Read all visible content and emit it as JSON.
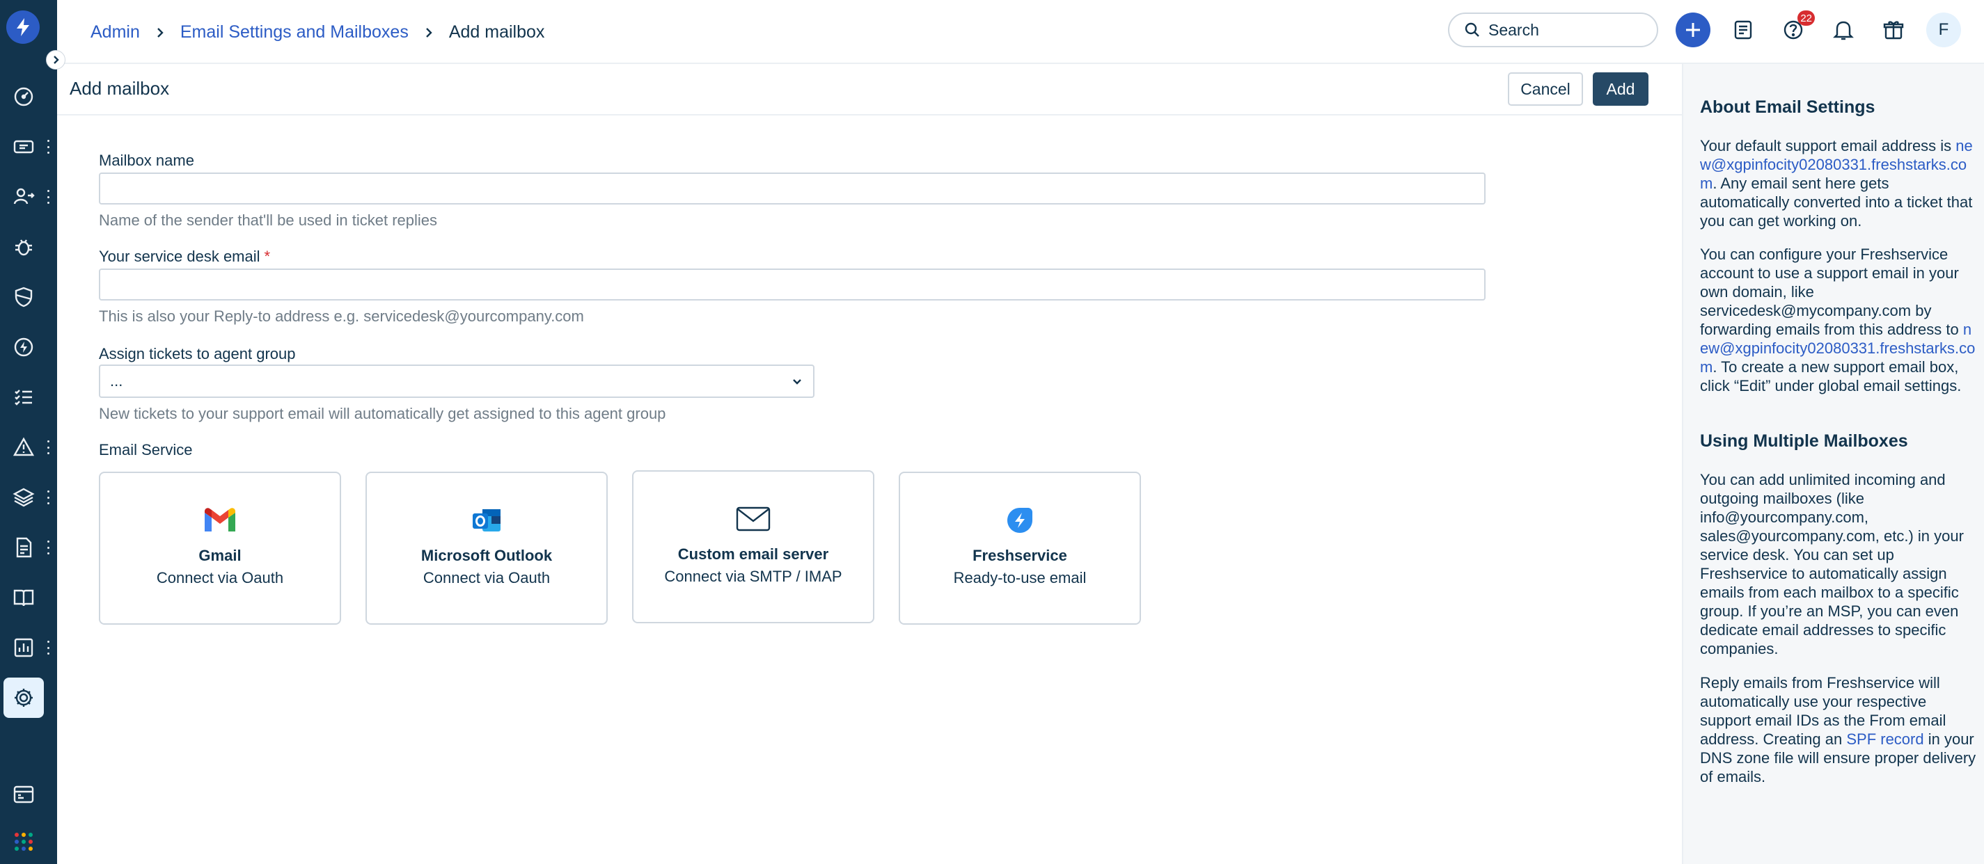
{
  "breadcrumb": {
    "items": [
      "Admin",
      "Email Settings and Mailboxes",
      "Add mailbox"
    ]
  },
  "header": {
    "search_placeholder": "Search",
    "notification_count": "22",
    "avatar_initial": "F"
  },
  "page": {
    "title": "Add mailbox",
    "cancel_label": "Cancel",
    "add_label": "Add"
  },
  "form": {
    "mailbox_name": {
      "label": "Mailbox name",
      "value": "",
      "hint": "Name of the sender that'll be used in ticket replies"
    },
    "service_email": {
      "label": "Your service desk email",
      "required_mark": "*",
      "value": "",
      "hint": "This is also your Reply-to address e.g. servicedesk@yourcompany.com"
    },
    "agent_group": {
      "label": "Assign tickets to agent group",
      "selected": "...",
      "hint": "New tickets to your support email will automatically get assigned to this agent group"
    },
    "email_service": {
      "label": "Email Service",
      "options": [
        {
          "name": "Gmail",
          "sub": "Connect via Oauth",
          "icon": "gmail-icon"
        },
        {
          "name": "Microsoft Outlook",
          "sub": "Connect via Oauth",
          "icon": "outlook-icon"
        },
        {
          "name": "Custom email server",
          "sub": "Connect via SMTP / IMAP",
          "icon": "envelope-icon"
        },
        {
          "name": "Freshservice",
          "sub": "Ready-to-use email",
          "icon": "freshservice-icon"
        }
      ]
    }
  },
  "aside": {
    "about_title": "About Email Settings",
    "about_p1_a": "Your default support email address is ",
    "about_p1_link": "new@xgpinfocity02080331.freshstarks.com",
    "about_p1_b": ". Any email sent here gets automatically converted into a ticket that you can get working on.",
    "about_p2_a": "You can configure your Freshservice account to use a support email in your own domain, like servicedesk@mycompany.com by forwarding emails from this address to ",
    "about_p2_link": "new@xgpinfocity02080331.freshstarks.com",
    "about_p2_b": ". To create a new support email box, click “Edit” under global email settings.",
    "multi_title": "Using Multiple Mailboxes",
    "multi_p1": "You can add unlimited incoming and outgoing mailboxes (like info@yourcompany.com, sales@yourcompany.com, etc.) in your service desk. You can set up Freshservice to automatically assign emails from each mailbox to a specific group. If you’re an MSP, you can even dedicate email addresses to specific companies.",
    "multi_p2_a": "Reply emails from Freshservice will automatically use your respective support email IDs as the From email address. Creating an ",
    "multi_p2_link": "SPF record",
    "multi_p2_b": " in your DNS zone file will ensure proper delivery of emails."
  },
  "colors": {
    "nav_bg": "#12344d",
    "brand_blue": "#2c5cc5",
    "primary_button": "#264966",
    "badge_red": "#d72d30",
    "aside_bg": "#f5f7f9"
  }
}
